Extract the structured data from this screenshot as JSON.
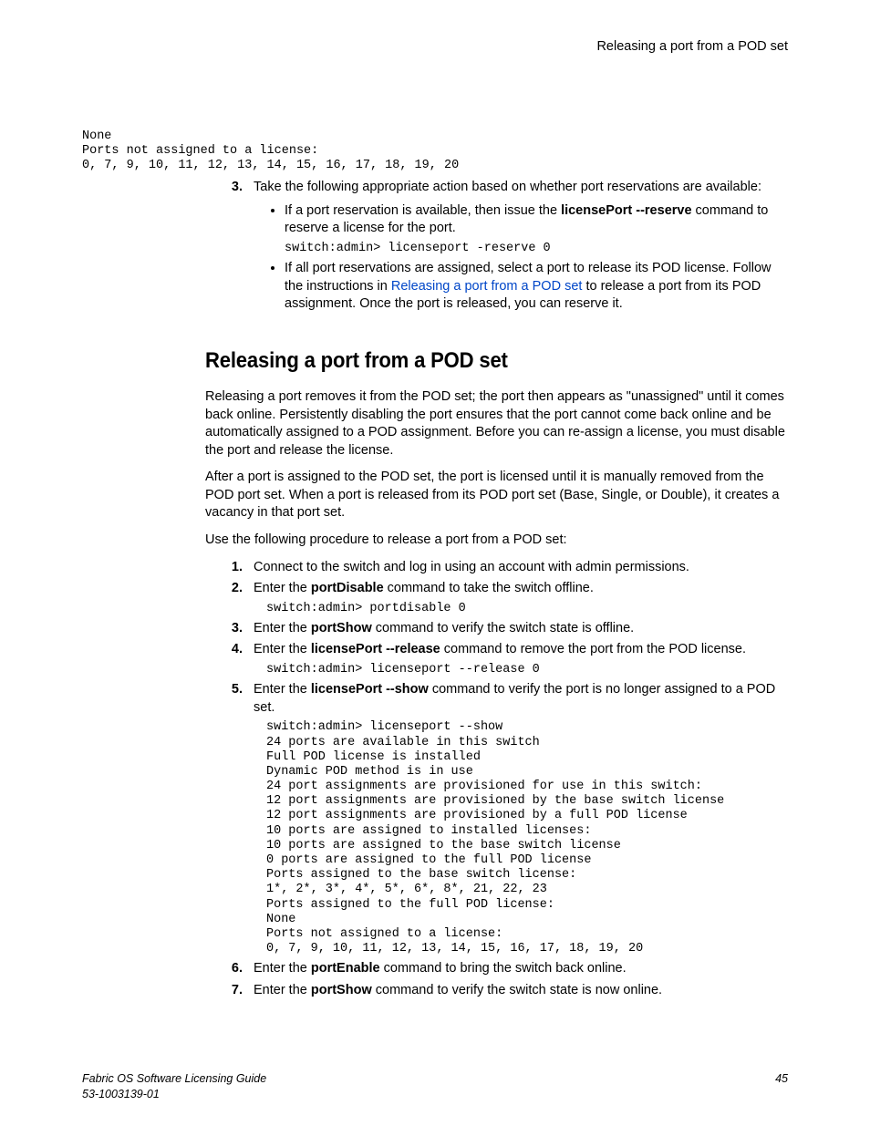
{
  "header": {
    "right": "Releasing a port from a POD set"
  },
  "top_code": "None\nPorts not assigned to a license:\n0, 7, 9, 10, 11, 12, 13, 14, 15, 16, 17, 18, 19, 20",
  "top_steps": {
    "start": 3,
    "item3": {
      "text": "Take the following appropriate action based on whether port reservations are available:",
      "bullets": {
        "b1": {
          "pre": "If a port reservation is available, then issue the ",
          "cmd": "licensePort --reserve",
          "post": " command to reserve a license for the port.",
          "code": "switch:admin> licenseport -reserve 0"
        },
        "b2": {
          "pre": "If all port reservations are assigned, select a port to release its POD license. Follow the instructions in ",
          "link": "Releasing a port from a POD set",
          "mid": " to release a port from its POD assignment. Once the port is released, you can reserve it."
        }
      }
    }
  },
  "section": {
    "title": "Releasing a port from a POD set",
    "p1": "Releasing a port removes it from the POD set; the port then appears as \"unassigned\" until it comes back online. Persistently disabling the port ensures that the port cannot come back online and be automatically assigned to a POD assignment. Before you can re-assign a license, you must disable the port and release the license.",
    "p2": "After a port is assigned to the POD set, the port is licensed until it is manually removed from the POD port set. When a port is released from its POD port set (Base, Single, or Double), it creates a vacancy in that port set.",
    "p3": "Use the following procedure to release a port from a POD set:",
    "steps": {
      "s1": "Connect to the switch and log in using an account with admin permissions.",
      "s2": {
        "pre": "Enter the ",
        "cmd": "portDisable",
        "post": " command to take the switch offline.",
        "code": "switch:admin> portdisable 0"
      },
      "s3": {
        "pre": "Enter the ",
        "cmd": "portShow",
        "post": " command to verify the switch state is offline."
      },
      "s4": {
        "pre": "Enter the ",
        "cmd": "licensePort --release",
        "post": " command to remove the port from the POD license.",
        "code": "switch:admin> licenseport --release 0"
      },
      "s5": {
        "pre": "Enter the ",
        "cmd": "licensePort --show",
        "post": " command to verify the port is no longer assigned to a POD set.",
        "code": "switch:admin> licenseport --show\n24 ports are available in this switch\nFull POD license is installed\nDynamic POD method is in use\n24 port assignments are provisioned for use in this switch:\n12 port assignments are provisioned by the base switch license\n12 port assignments are provisioned by a full POD license\n10 ports are assigned to installed licenses:\n10 ports are assigned to the base switch license\n0 ports are assigned to the full POD license\nPorts assigned to the base switch license:\n1*, 2*, 3*, 4*, 5*, 6*, 8*, 21, 22, 23\nPorts assigned to the full POD license:\nNone\nPorts not assigned to a license:\n0, 7, 9, 10, 11, 12, 13, 14, 15, 16, 17, 18, 19, 20"
      },
      "s6": {
        "pre": "Enter the ",
        "cmd": "portEnable",
        "post": " command to bring the switch back online."
      },
      "s7": {
        "pre": "Enter the ",
        "cmd": "portShow",
        "post": " command to verify the switch state is now online."
      }
    }
  },
  "footer": {
    "left1": "Fabric OS Software Licensing Guide",
    "left2": "53-1003139-01",
    "page": "45"
  }
}
